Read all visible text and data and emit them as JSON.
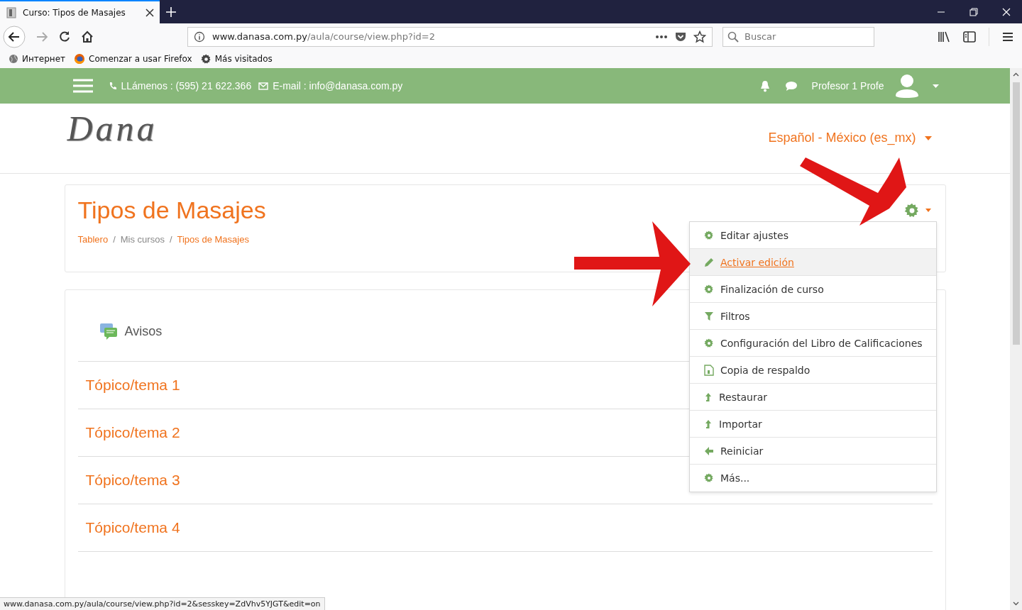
{
  "browser": {
    "tab_title": "Curso: Tipos de Masajes",
    "url_host": "www.danasa.com.py",
    "url_path": "/aula/course/view.php?id=2",
    "search_placeholder": "Buscar",
    "bookmarks": [
      {
        "label": "Интернет",
        "kind": "globe"
      },
      {
        "label": "Comenzar a usar Firefox",
        "kind": "firefox"
      },
      {
        "label": "Más visitados",
        "kind": "gear"
      }
    ]
  },
  "header": {
    "phone": "LLámenos : (595) 21 622.366",
    "email": "E-mail : info@danasa.com.py",
    "user_name": "Profesor 1 Profe"
  },
  "logo": "Dana",
  "language": "Español - México (es_mx)",
  "course": {
    "title": "Tipos de Masajes",
    "breadcrumb": [
      {
        "label": "Tablero",
        "link": true
      },
      {
        "separator": "/",
        "label": "Mis cursos",
        "link": false
      },
      {
        "separator": "/",
        "label": "Tipos de Masajes",
        "link": true
      }
    ]
  },
  "actions_menu": {
    "items": [
      {
        "label": "Editar ajustes",
        "kind": "gear",
        "selected": false
      },
      {
        "label": "Activar edición",
        "kind": "pencil",
        "selected": true
      },
      {
        "label": "Finalización de curso",
        "kind": "gear",
        "selected": false
      },
      {
        "label": "Filtros",
        "kind": "funnel",
        "selected": false
      },
      {
        "label": "Configuración del Libro de Calificaciones",
        "kind": "gear",
        "selected": false
      },
      {
        "label": "Copia de respaldo",
        "kind": "file",
        "selected": false
      },
      {
        "label": "Restaurar",
        "kind": "upload",
        "selected": false
      },
      {
        "label": "Importar",
        "kind": "upload",
        "selected": false
      },
      {
        "label": "Reiniciar",
        "kind": "back",
        "selected": false
      },
      {
        "label": "Más...",
        "kind": "gear",
        "selected": false
      }
    ]
  },
  "section": {
    "announcements": "Avisos",
    "topics": [
      "Tópico/tema 1",
      "Tópico/tema 2",
      "Tópico/tema 3",
      "Tópico/tema 4"
    ]
  },
  "status_bar": "www.danasa.com.py/aula/course/view.php?id=2&sesskey=ZdVhv5YJGT&edit=on"
}
